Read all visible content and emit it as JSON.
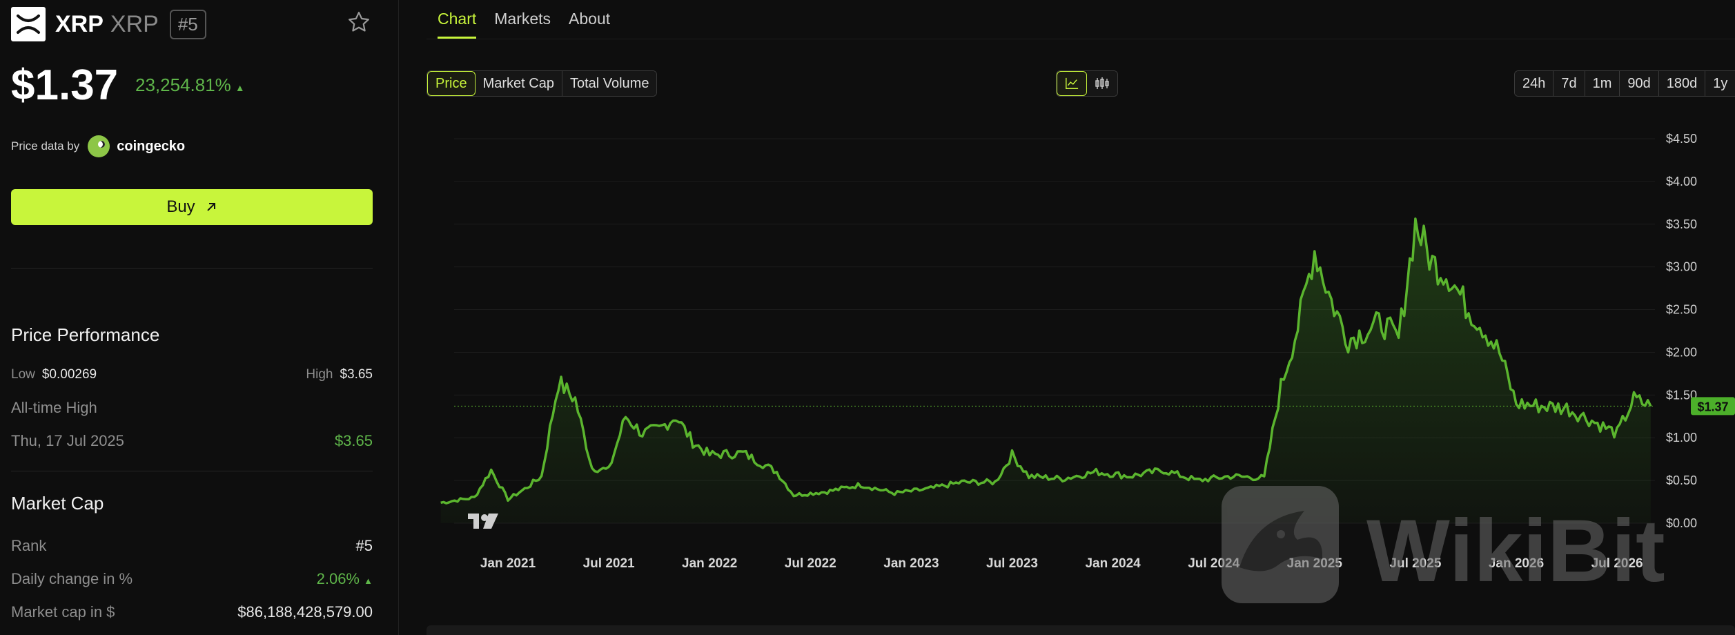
{
  "coin": {
    "name": "XRP",
    "symbol": "XRP",
    "rank": "#5"
  },
  "price": {
    "value": "$1.37",
    "change": "23,254.81%",
    "change_arrow": "▲"
  },
  "provider": {
    "label": "Price data by",
    "name": "coingecko"
  },
  "buy": {
    "label": "Buy"
  },
  "performance": {
    "title": "Price Performance",
    "low_label": "Low",
    "low_value": "$0.00269",
    "high_label": "High",
    "high_value": "$3.65",
    "ath_label": "All-time High",
    "ath_date": "Thu, 17 Jul 2025",
    "ath_value": "$3.65"
  },
  "market": {
    "title": "Market Cap",
    "rank_label": "Rank",
    "rank_value": "#5",
    "daily_label": "Daily change in %",
    "daily_value": "2.06%",
    "daily_arrow": "▲",
    "cap_label": "Market cap in $",
    "cap_value": "$86,188,428,579.00"
  },
  "tabs": [
    "Chart",
    "Markets",
    "About"
  ],
  "metric_tabs": [
    "Price",
    "Market Cap",
    "Total Volume"
  ],
  "range_tabs": [
    "24h",
    "7d",
    "1m",
    "90d",
    "180d",
    "1y"
  ],
  "watermark": "WikiBit",
  "colors": {
    "accent": "#c8f53b",
    "up": "#5fb64a",
    "line": "#5bb52e",
    "background": "#0e0e0e"
  },
  "chart_data": {
    "type": "area",
    "current_label": "$1.37",
    "x_ticks": [
      "Jan 2021",
      "Jul 2021",
      "Jan 2022",
      "Jul 2022",
      "Jan 2023",
      "Jul 2023",
      "Jan 2024",
      "Jul 2024",
      "Jan 2025",
      "Jul 2025",
      "Jan 2026",
      "Jul 2026"
    ],
    "y_ticks": [
      "$0.00",
      "$0.50",
      "$1.00",
      "$1.50",
      "$2.00",
      "$2.50",
      "$3.00",
      "$3.50",
      "$4.00",
      "$4.50"
    ],
    "ylim": [
      0,
      4.5
    ],
    "current_value": 1.37,
    "series": [
      {
        "x": [
          "2020-09",
          "2020-11",
          "2020-12",
          "2021-01",
          "2021-02",
          "2021-03",
          "2021-04",
          "2021-05",
          "2021-06",
          "2021-07",
          "2021-08",
          "2021-09",
          "2021-10",
          "2021-11",
          "2021-12",
          "2022-01",
          "2022-03",
          "2022-05",
          "2022-06",
          "2022-08",
          "2022-10",
          "2022-12",
          "2023-02",
          "2023-04",
          "2023-06",
          "2023-07",
          "2023-08",
          "2023-10",
          "2023-12",
          "2024-02",
          "2024-04",
          "2024-06",
          "2024-08",
          "2024-10",
          "2024-11",
          "2024-12",
          "2025-01",
          "2025-02",
          "2025-03",
          "2025-04",
          "2025-05",
          "2025-06",
          "2025-07",
          "2025-08",
          "2025-09",
          "2025-10",
          "2025-11",
          "2025-12",
          "2026-01",
          "2026-02",
          "2026-04",
          "2026-06",
          "2026-07",
          "2026-08",
          "2026-09"
        ],
        "y": [
          0.24,
          0.3,
          0.62,
          0.28,
          0.4,
          0.55,
          1.65,
          1.45,
          0.65,
          0.62,
          1.25,
          1.05,
          1.1,
          1.25,
          0.95,
          0.8,
          0.82,
          0.6,
          0.33,
          0.37,
          0.45,
          0.35,
          0.4,
          0.48,
          0.48,
          0.8,
          0.55,
          0.52,
          0.6,
          0.55,
          0.62,
          0.5,
          0.55,
          0.53,
          1.6,
          2.3,
          3.2,
          2.6,
          2.15,
          2.25,
          2.35,
          2.15,
          3.5,
          3.05,
          2.9,
          2.55,
          2.3,
          2.0,
          1.4,
          1.38,
          1.35,
          1.15,
          1.05,
          1.45,
          1.37
        ]
      }
    ]
  }
}
